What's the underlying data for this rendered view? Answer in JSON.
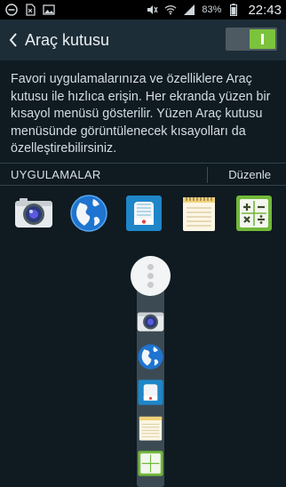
{
  "status_bar": {
    "left_icons": [
      "minus-circle-icon",
      "no-sim-icon",
      "image-icon"
    ],
    "right_icons": [
      "mute-icon",
      "wifi-icon",
      "signal-icon"
    ],
    "battery_percent": "83%",
    "battery_icon": "battery-icon",
    "time": "22:43"
  },
  "action_bar": {
    "back_icon": "chevron-left-icon",
    "title": "Araç kutusu",
    "toggle_on": true
  },
  "description": "Favori uygulamalarınıza ve özelliklere Araç kutusu ile hızlıca erişin. Her ekranda yüzen bir kısayol menüsü gösterilir. Yüzen Araç kutusu menüsünde görüntülenecek kısayolları da özelleştirebilirsiniz.",
  "apps_section": {
    "label": "UYGULAMALAR",
    "edit_label": "Düzenle",
    "apps": [
      {
        "name": "camera-icon"
      },
      {
        "name": "internet-globe-icon"
      },
      {
        "name": "voice-recorder-icon"
      },
      {
        "name": "memo-icon"
      },
      {
        "name": "calculator-icon"
      }
    ]
  },
  "floating_menu": {
    "handle_icon": "more-dots-icon",
    "items": [
      "camera-icon",
      "internet-globe-icon",
      "voice-recorder-icon",
      "memo-icon",
      "calculator-icon"
    ]
  },
  "colors": {
    "background": "#0f1a21",
    "action_bar": "#1d2d37",
    "toggle_on": "#7cc33d"
  }
}
